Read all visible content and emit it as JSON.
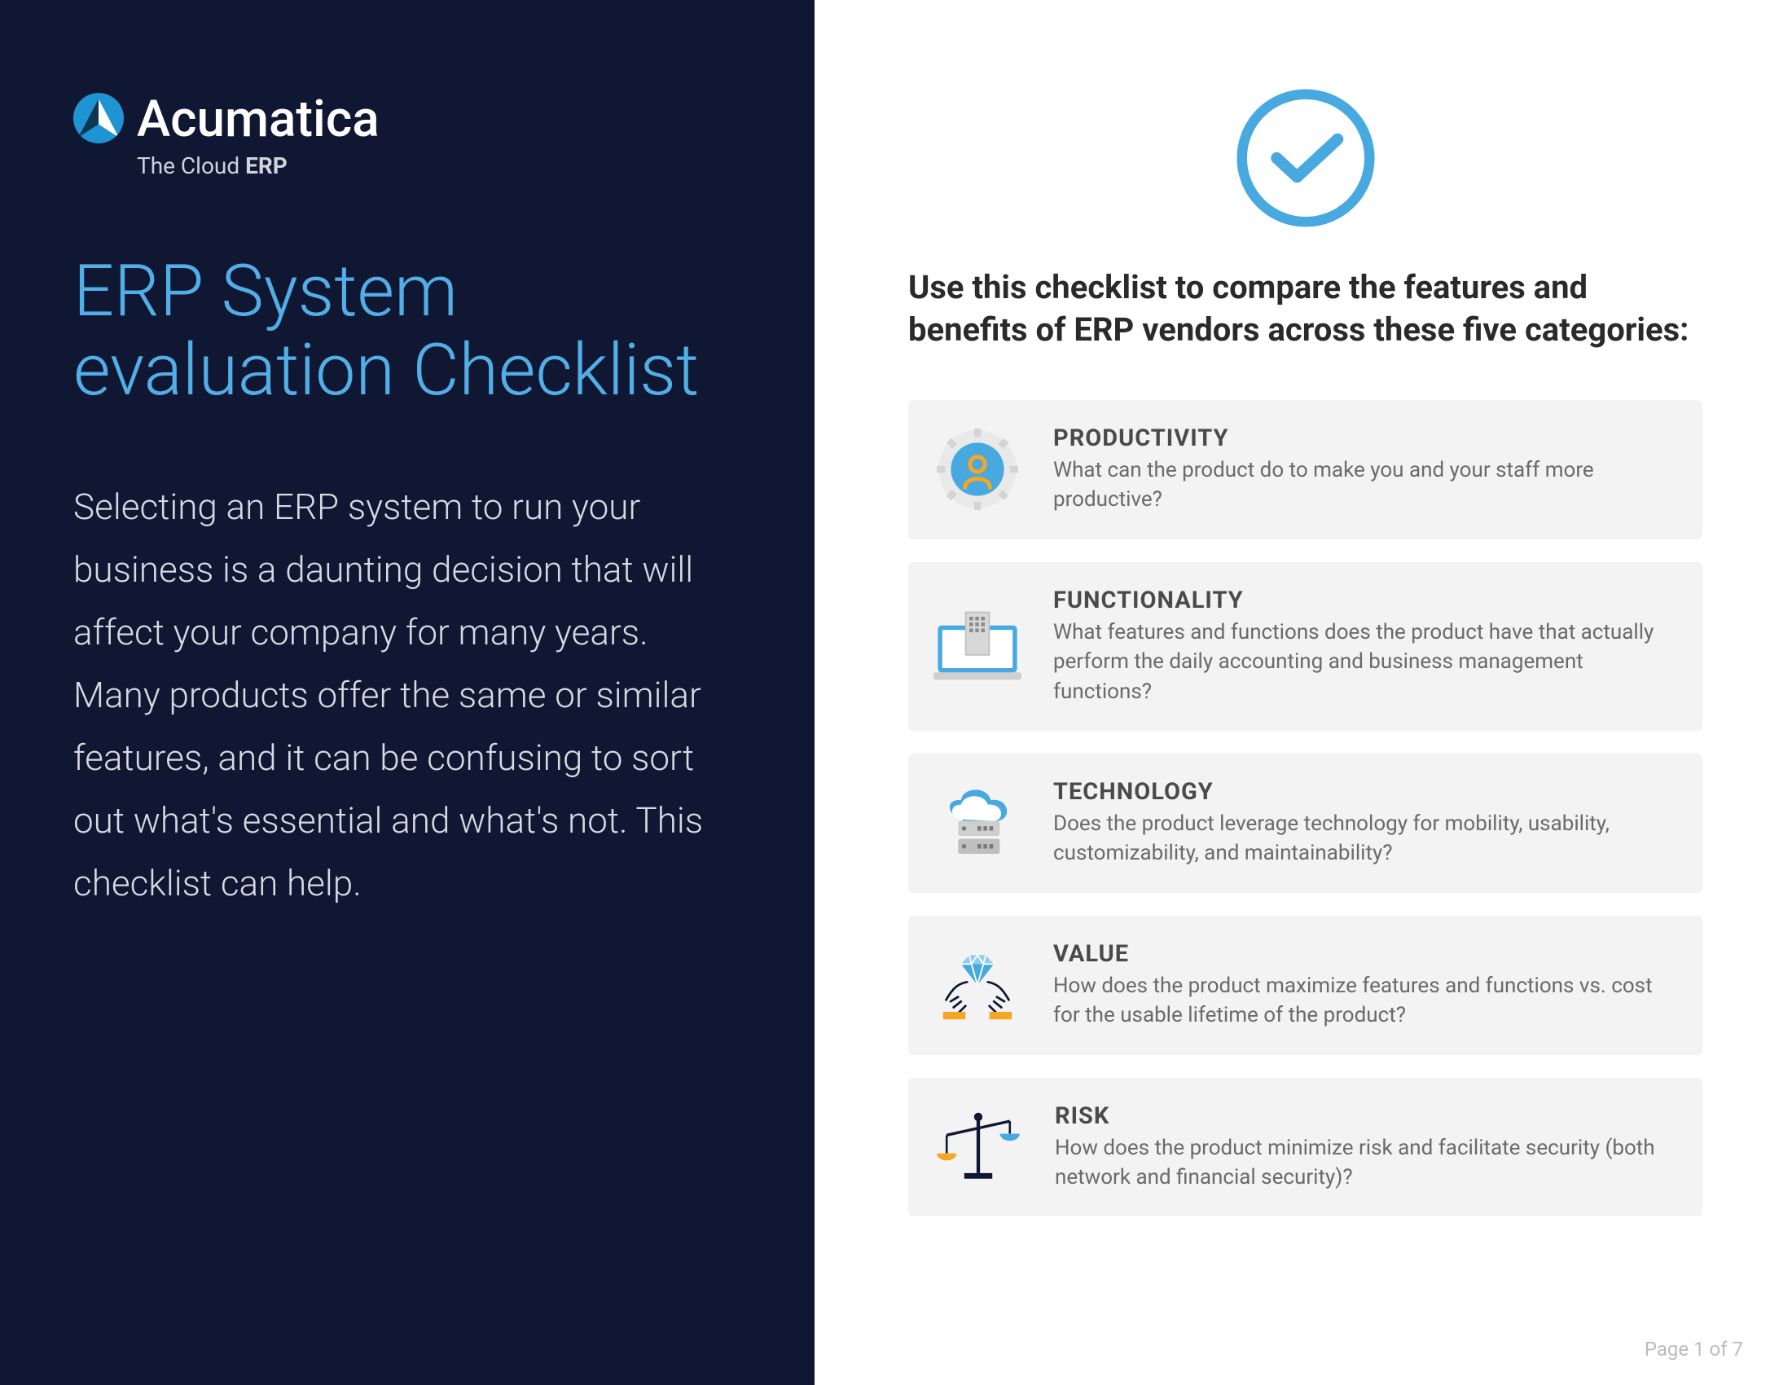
{
  "brand": {
    "name": "Acumatica",
    "tagline_pre": "The Cloud ",
    "tagline_bold": "ERP"
  },
  "title_line1": "ERP System",
  "title_line2": "evaluation Checklist",
  "intro": "Selecting an ERP system to run your business is a daunting decision that will affect your company for many years. Many products offer the same or similar features, and it can be confusing to sort out what's essential and what's not. This checklist can help.",
  "right_heading": "Use this checklist to compare the features and benefits of ERP vendors across these five categories:",
  "categories": [
    {
      "title": "PRODUCTIVITY",
      "desc": "What can the product do to make you and your staff more productive?"
    },
    {
      "title": "FUNCTIONALITY",
      "desc": "What features and functions does the product have that actually perform the daily accounting and business management functions?"
    },
    {
      "title": "TECHNOLOGY",
      "desc": "Does the product leverage technology for mobility, usability, customizability, and maintainability?"
    },
    {
      "title": "VALUE",
      "desc": "How does the product maximize features and functions vs. cost for the usable lifetime of the product?"
    },
    {
      "title": "RISK",
      "desc": "How does the product minimize risk and facilitate security (both network and financial security)?"
    }
  ],
  "footer": "Page 1 of 7",
  "colors": {
    "navy": "#0f1733",
    "accent": "#48a8e0",
    "orange": "#f5a623",
    "gray_card": "#f3f3f3"
  }
}
